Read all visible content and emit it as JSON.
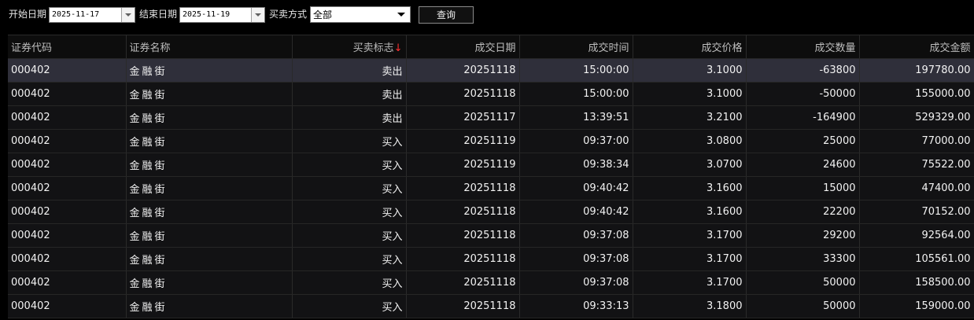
{
  "toolbar": {
    "start_label": "开始日期",
    "start_value": "2025-11-17",
    "end_label": "结束日期",
    "end_value": "2025-11-19",
    "type_label": "买卖方式",
    "type_value": "全部",
    "query_label": "查询"
  },
  "table": {
    "headers": [
      "证券代码",
      "证券名称",
      "买卖标志",
      "成交日期",
      "成交时间",
      "成交价格",
      "成交数量",
      "成交金额"
    ],
    "sort_indicator": "↓",
    "rows": [
      {
        "code": "000402",
        "name": "金融街",
        "flag": "卖出",
        "date": "20251118",
        "time": "15:00:00",
        "price": "3.1000",
        "qty": "-63800",
        "amount": "197780.00"
      },
      {
        "code": "000402",
        "name": "金融街",
        "flag": "卖出",
        "date": "20251118",
        "time": "15:00:00",
        "price": "3.1000",
        "qty": "-50000",
        "amount": "155000.00"
      },
      {
        "code": "000402",
        "name": "金融街",
        "flag": "卖出",
        "date": "20251117",
        "time": "13:39:51",
        "price": "3.2100",
        "qty": "-164900",
        "amount": "529329.00"
      },
      {
        "code": "000402",
        "name": "金融街",
        "flag": "买入",
        "date": "20251119",
        "time": "09:37:00",
        "price": "3.0800",
        "qty": "25000",
        "amount": "77000.00"
      },
      {
        "code": "000402",
        "name": "金融街",
        "flag": "买入",
        "date": "20251119",
        "time": "09:38:34",
        "price": "3.0700",
        "qty": "24600",
        "amount": "75522.00"
      },
      {
        "code": "000402",
        "name": "金融街",
        "flag": "买入",
        "date": "20251118",
        "time": "09:40:42",
        "price": "3.1600",
        "qty": "15000",
        "amount": "47400.00"
      },
      {
        "code": "000402",
        "name": "金融街",
        "flag": "买入",
        "date": "20251118",
        "time": "09:40:42",
        "price": "3.1600",
        "qty": "22200",
        "amount": "70152.00"
      },
      {
        "code": "000402",
        "name": "金融街",
        "flag": "买入",
        "date": "20251118",
        "time": "09:37:08",
        "price": "3.1700",
        "qty": "29200",
        "amount": "92564.00"
      },
      {
        "code": "000402",
        "name": "金融街",
        "flag": "买入",
        "date": "20251118",
        "time": "09:37:08",
        "price": "3.1700",
        "qty": "33300",
        "amount": "105561.00"
      },
      {
        "code": "000402",
        "name": "金融街",
        "flag": "买入",
        "date": "20251118",
        "time": "09:37:08",
        "price": "3.1700",
        "qty": "50000",
        "amount": "158500.00"
      },
      {
        "code": "000402",
        "name": "金融街",
        "flag": "买入",
        "date": "20251118",
        "time": "09:33:13",
        "price": "3.1800",
        "qty": "50000",
        "amount": "159000.00"
      }
    ]
  },
  "colors": {
    "sell": "#3c8bff",
    "buy": "#ff3b3b",
    "selected_row": "#2f2f3a"
  }
}
